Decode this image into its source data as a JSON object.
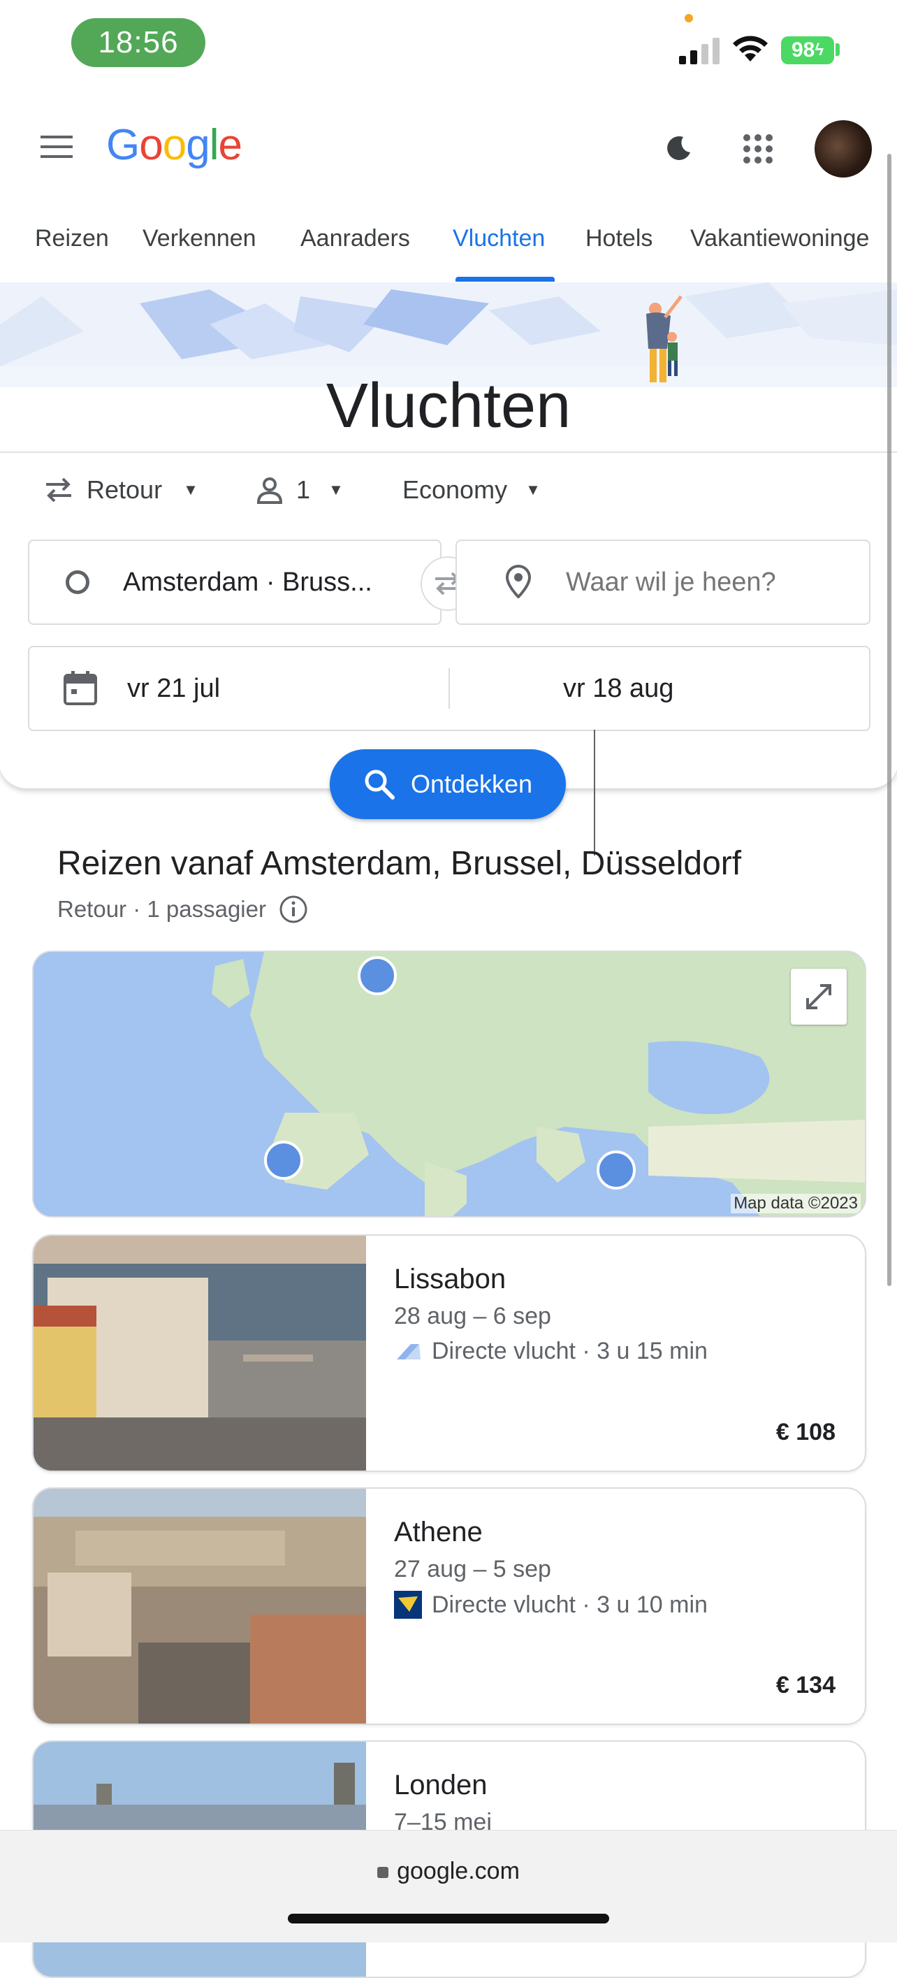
{
  "status_bar": {
    "time": "18:56",
    "battery": "98"
  },
  "header": {
    "logo": [
      "G",
      "o",
      "o",
      "g",
      "l",
      "e"
    ],
    "logo_colors": [
      "#4285F4",
      "#EA4335",
      "#FBBC05",
      "#4285F4",
      "#34A853",
      "#EA4335"
    ]
  },
  "tabs": [
    {
      "label": "Reizen",
      "active": false
    },
    {
      "label": "Verkennen",
      "active": false
    },
    {
      "label": "Aanraders",
      "active": false
    },
    {
      "label": "Vluchten",
      "active": true
    },
    {
      "label": "Hotels",
      "active": false
    },
    {
      "label": "Vakantiewoninge",
      "active": false
    }
  ],
  "page_title": "Vluchten",
  "search": {
    "trip_type": "Retour",
    "passengers": "1",
    "cabin_class": "Economy",
    "origin_value": "Amsterdam · Bruss...",
    "destination_placeholder": "Waar wil je heen?",
    "depart_date": "vr 21 jul",
    "return_date": "vr 18 aug",
    "button_label": "Ontdekken"
  },
  "section": {
    "title": "Reizen vanaf Amsterdam, Brussel, Düsseldorf",
    "subtitle": "Retour · 1 passagier"
  },
  "map": {
    "attribution": "Map data ©2023"
  },
  "destinations": [
    {
      "name": "Lissabon",
      "dates": "28 aug – 6 sep",
      "flight": "Directe vlucht · 3 u 15 min",
      "price": "€ 108"
    },
    {
      "name": "Athene",
      "dates": "27 aug – 5 sep",
      "flight": "Directe vlucht · 3 u 10 min",
      "price": "€ 134"
    },
    {
      "name": "Londen",
      "dates": "7–15 mei",
      "flight": "",
      "price": ""
    }
  ],
  "browser": {
    "url": "google.com"
  },
  "colors": {
    "accent": "#1a73e8",
    "status_pill": "#52a857",
    "battery": "#4bd964"
  }
}
